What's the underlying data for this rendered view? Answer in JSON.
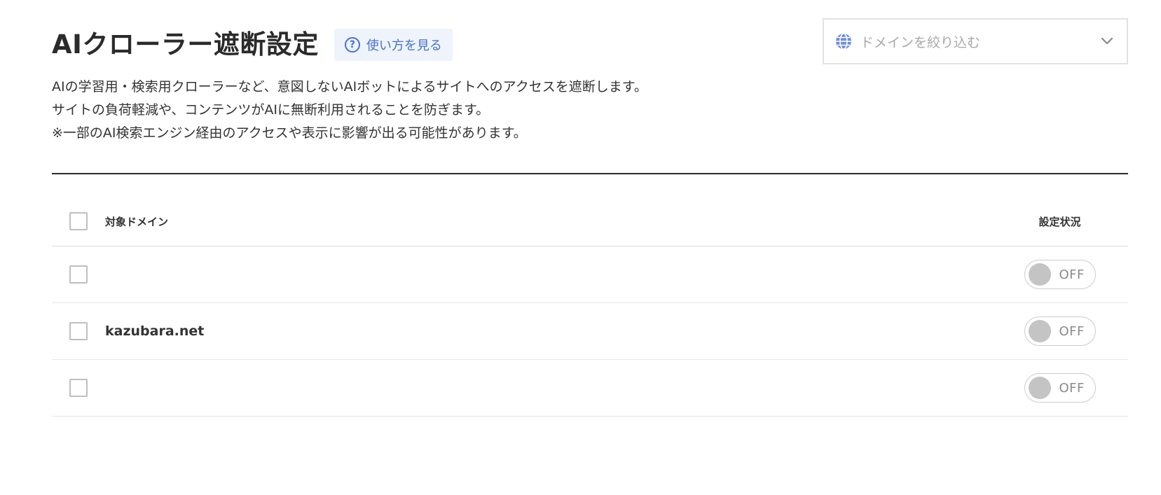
{
  "header": {
    "title": "AIクローラー遮断設定",
    "help_link": "使い方を見る"
  },
  "description": {
    "lines": [
      "AIの学習用・検索用クローラーなど、意図しないAIボットによるサイトへのアクセスを遮断します。",
      "サイトの負荷軽減や、コンテンツがAIに無断利用されることを防ぎます。",
      "※一部のAI検索エンジン経由のアクセスや表示に影響が出る可能性があります。"
    ]
  },
  "domain_filter": {
    "placeholder": "ドメインを絞り込む",
    "icon": "globe-icon"
  },
  "table": {
    "columns": {
      "domain": "対象ドメイン",
      "status": "設定状況"
    },
    "rows": [
      {
        "domain": "",
        "status": "OFF",
        "checked": false
      },
      {
        "domain": "kazubara.net",
        "status": "OFF",
        "checked": false
      },
      {
        "domain": "",
        "status": "OFF",
        "checked": false
      }
    ]
  },
  "colors": {
    "accent": "#4a72c9",
    "help_bg": "#eef3fc",
    "toggle_knob_off": "#c4c4c4",
    "divider": "#2b2b2b"
  }
}
